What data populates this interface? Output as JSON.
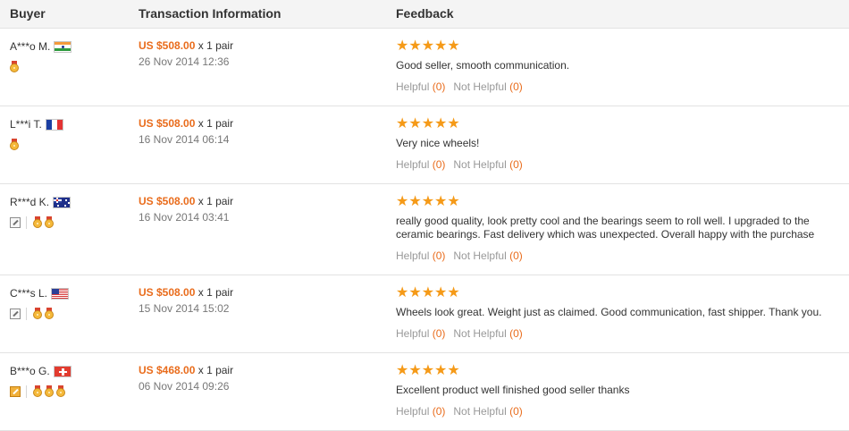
{
  "header": {
    "buyer": "Buyer",
    "transaction": "Transaction Information",
    "feedback": "Feedback"
  },
  "labels": {
    "helpful": "Helpful",
    "not_helpful": "Not Helpful",
    "stars": "★★★★★"
  },
  "colors": {
    "price": "#e96c1c",
    "stars": "#f59a18",
    "header_bg": "#f4f4f4",
    "border": "#e2e2e2"
  },
  "reviews": [
    {
      "buyer": "A***o M.",
      "flag": "india-flag",
      "price": "US $508.00",
      "qty": "x 1 pair",
      "date": "26 Nov 2014 12:36",
      "rating": 5,
      "comment": "Good seller, smooth communication.",
      "helpful_count": "(0)",
      "not_helpful_count": "(0)",
      "badges": [
        "medal"
      ]
    },
    {
      "buyer": "L***i T.",
      "flag": "france-flag",
      "price": "US $508.00",
      "qty": "x 1 pair",
      "date": "16 Nov 2014 06:14",
      "rating": 5,
      "comment": "Very nice wheels!",
      "helpful_count": "(0)",
      "not_helpful_count": "(0)",
      "badges": [
        "medal"
      ]
    },
    {
      "buyer": "R***d K.",
      "flag": "australia-flag",
      "price": "US $508.00",
      "qty": "x 1 pair",
      "date": "16 Nov 2014 03:41",
      "rating": 5,
      "comment": "really good quality, look pretty cool and the bearings seem to roll well. I upgraded to the ceramic bearings. Fast delivery which was unexpected. Overall happy with the purchase",
      "helpful_count": "(0)",
      "not_helpful_count": "(0)",
      "badges": [
        "box",
        "medal",
        "medal"
      ]
    },
    {
      "buyer": "C***s L.",
      "flag": "usa-flag",
      "price": "US $508.00",
      "qty": "x 1 pair",
      "date": "15 Nov 2014 15:02",
      "rating": 5,
      "comment": "Wheels look great. Weight just as claimed. Good communication, fast shipper. Thank you.",
      "helpful_count": "(0)",
      "not_helpful_count": "(0)",
      "badges": [
        "box",
        "medal",
        "medal"
      ]
    },
    {
      "buyer": "B***o G.",
      "flag": "switzerland-flag",
      "price": "US $468.00",
      "qty": "x 1 pair",
      "date": "06 Nov 2014 09:26",
      "rating": 5,
      "comment": "Excellent product well finished good seller thanks",
      "helpful_count": "(0)",
      "not_helpful_count": "(0)",
      "badges": [
        "box-gold",
        "medal",
        "medal",
        "medal"
      ]
    }
  ]
}
